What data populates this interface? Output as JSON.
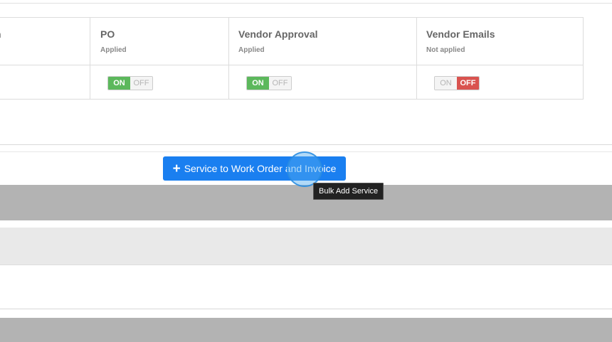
{
  "settings_table": {
    "columns": [
      {
        "title": "n",
        "subtitle": ""
      },
      {
        "title": "PO",
        "subtitle": "Applied",
        "toggle": {
          "on": "ON",
          "off": "OFF",
          "state": "on"
        }
      },
      {
        "title": "Vendor Approval",
        "subtitle": "Applied",
        "toggle": {
          "on": "ON",
          "off": "OFF",
          "state": "on"
        }
      },
      {
        "title": "Vendor Emails",
        "subtitle": "Not applied",
        "toggle": {
          "on": "ON",
          "off": "OFF",
          "state": "off"
        }
      }
    ]
  },
  "add_service_button": {
    "icon": "plus-icon",
    "label": "Service to Work Order and Invoice"
  },
  "tooltip": {
    "text": "Bulk Add Service"
  },
  "colors": {
    "on_green": "#5cb85c",
    "off_red": "#d9534f",
    "button_blue": "#1a7ff0",
    "band_dark": "#b3b3b3",
    "band_light": "#e9e9e9"
  }
}
